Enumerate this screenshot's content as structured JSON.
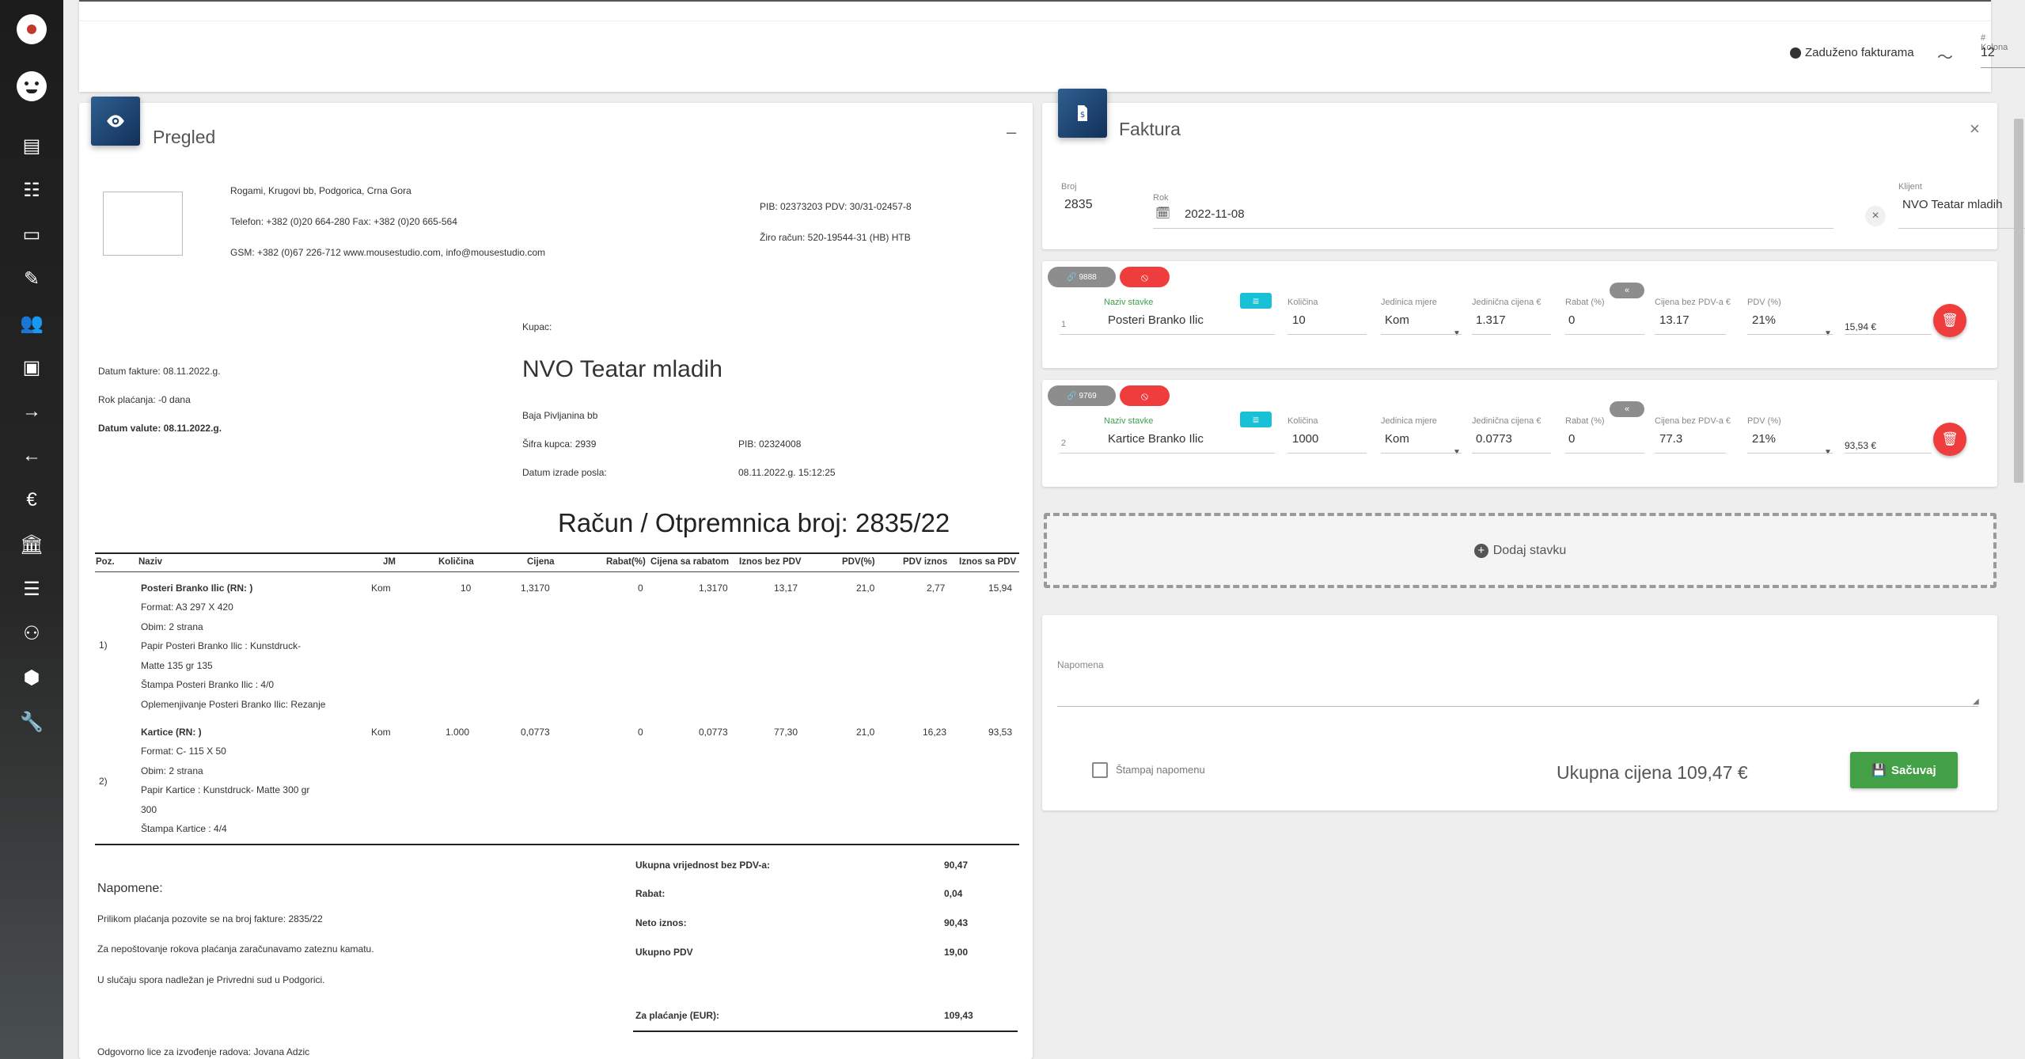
{
  "sidebar": {
    "items": [
      "app-logo",
      "user-avatar",
      "invoices",
      "forms",
      "notes",
      "edit",
      "users",
      "archive",
      "arrow-right",
      "arrow-left",
      "euro",
      "bank",
      "list-check",
      "group",
      "hexagon",
      "wrench"
    ]
  },
  "topbar": {
    "legend_text": "Zaduženo fakturama",
    "columns_label": "# Kolona",
    "columns_value": "12"
  },
  "preview": {
    "title": "Pregled",
    "company": {
      "address": "Rogami, Krugovi bb, Podgorica, Crna Gora",
      "phone": "Telefon: +382 (0)20 664-280 Fax: +382 (0)20 665-564",
      "gsm": "GSM: +382 (0)67 226-712 www.mousestudio.com, info@mousestudio.com",
      "pib": "PIB: 02373203 PDV: 30/31-02457-8",
      "account": "Žiro račun: 520-19544-31 (HB) HTB"
    },
    "buyer_label": "Kupac:",
    "buyer_name": "NVO Teatar mladih",
    "buyer_address": "Baja Pivljanina bb",
    "buyer_code": "Šifra kupca: 2939",
    "buyer_pib": "PIB: 02324008",
    "created_label": "Datum izrade posla:",
    "created_value": "08.11.2022.g. 15:12:25",
    "invoice_date": "Datum fakture: 08.11.2022.g.",
    "due": "Rok plaćanja:    -0 dana",
    "value_date": "Datum valute: 08.11.2022.g.",
    "doc_title": "Račun / Otpremnica broj: 2835/22",
    "table_headers": [
      "Poz.",
      "Naziv",
      "JM",
      "Količina",
      "Cijena",
      "Rabat(%)",
      "Cijena sa rabatom",
      "Iznos bez PDV",
      "PDV(%)",
      "PDV iznos",
      "Iznos sa PDV"
    ],
    "rows": [
      {
        "pos": "1)",
        "name": "Posteri Branko Ilic (RN: )",
        "details": [
          "Format: A3 297 X 420",
          "Obim: 2 strana",
          "Papir Posteri Branko Ilic : Kunstdruck-",
          "Matte 135 gr 135",
          "Štampa Posteri Branko Ilic : 4/0",
          "Oplemenjivanje Posteri Branko Ilic: Rezanje"
        ],
        "jm": "Kom",
        "qty": "10",
        "price": "1,3170",
        "discount": "0",
        "price_disc": "1,3170",
        "net": "13,17",
        "vat_pct": "21,0",
        "vat": "2,77",
        "total": "15,94"
      },
      {
        "pos": "2)",
        "name": "Kartice (RN: )",
        "details": [
          "Format: C- 115 X 50",
          "Obim: 2 strana",
          "Papir Kartice : Kunstdruck- Matte 300 gr",
          "300",
          "Štampa Kartice : 4/4"
        ],
        "jm": "Kom",
        "qty": "1.000",
        "price": "0,0773",
        "discount": "0",
        "price_disc": "0,0773",
        "net": "77,30",
        "vat_pct": "21,0",
        "vat": "16,23",
        "total": "93,53"
      }
    ],
    "notes_title": "Napomene:",
    "notes": [
      "Prilikom plaćanja pozovite se na broj fakture: 2835/22",
      "Za nepoštovanje rokova plaćanja zaračunavamo zateznu kamatu.",
      "U slučaju spora nadležan je Privredni sud u Podgorici."
    ],
    "totals": [
      {
        "label": "Ukupna vrijednost bez PDV-a:",
        "value": "90,47"
      },
      {
        "label": "Rabat:",
        "value": "0,04"
      },
      {
        "label": "Neto iznos:",
        "value": "90,43"
      },
      {
        "label": "Ukupno PDV",
        "value": "19,00"
      },
      {
        "label": "Za plaćanje (EUR):",
        "value": "109,43"
      }
    ],
    "responsible": "Odgovorno lice za izvođenje radova: Jovana Adzic"
  },
  "faktura": {
    "title": "Faktura",
    "broj_label": "Broj",
    "broj_value": "2835",
    "rok_label": "Rok",
    "rok_value": "2022-11-08",
    "klijent_label": "Klijent",
    "klijent_value": "NVO Teatar mladih"
  },
  "items": [
    {
      "badge": "9888",
      "index": "1",
      "naziv_label": "Naziv stavke",
      "naziv": "Posteri Branko Ilic",
      "kolicina_label": "Količina",
      "kolicina": "10",
      "jm_label": "Jedinica mjere",
      "jm": "Kom",
      "cijena_label": "Jedinična cijena €",
      "cijena": "1.317",
      "rabat_label": "Rabat (%)",
      "rabat": "0",
      "bez_pdv_label": "Cijena bez PDV-a €",
      "bez_pdv": "13.17",
      "pdv_label": "PDV (%)",
      "pdv": "21%",
      "total": "15,94 €"
    },
    {
      "badge": "9769",
      "index": "2",
      "naziv_label": "Naziv stavke",
      "naziv": "Kartice Branko Ilic",
      "kolicina_label": "Količina",
      "kolicina": "1000",
      "jm_label": "Jedinica mjere",
      "jm": "Kom",
      "cijena_label": "Jedinična cijena €",
      "cijena": "0.0773",
      "rabat_label": "Rabat (%)",
      "rabat": "0",
      "bez_pdv_label": "Cijena bez PDV-a €",
      "bez_pdv": "77.3",
      "pdv_label": "PDV (%)",
      "pdv": "21%",
      "total": "93,53 €"
    }
  ],
  "add_item": "Dodaj stavku",
  "notes": {
    "label": "Napomena",
    "print_label": "Štampaj napomenu",
    "total": "Ukupna cijena 109,47 €",
    "save": "Sačuvaj"
  },
  "colors": {
    "accent_blue": "#1f4f7f",
    "danger": "#ef3d3d",
    "success": "#43a047",
    "info": "#19c1d6"
  }
}
